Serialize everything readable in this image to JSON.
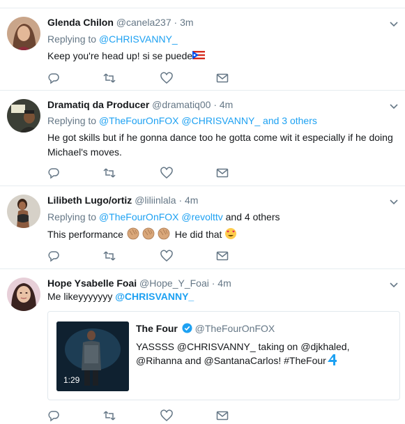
{
  "tweets": [
    {
      "name": "Glenda Chilon",
      "handle": "@canela237",
      "time": "3m",
      "reply_prefix": "Replying to",
      "reply_targets": "@CHRISVANNY_",
      "text": "Keep you're head up! si se puede",
      "emoji": "flag-puerto-rico-icon"
    },
    {
      "name": "Dramatiq da Producer",
      "handle": "@dramatiq00",
      "time": "4m",
      "reply_prefix": "Replying to",
      "reply_targets": "@TheFourOnFOX @CHRISVANNY_",
      "reply_others": "and 3 others",
      "text": "He got skills but if he gonna dance too he gotta come wit it especially if he doing Michael's moves."
    },
    {
      "name": "Lilibeth Lugo/ortiz",
      "handle": "@liliinlala",
      "time": "4m",
      "reply_prefix": "Replying to",
      "reply_targets": "@TheFourOnFOX @revolttv",
      "reply_others": "and 4 others",
      "text_before": "This performance",
      "text_after": "He did that"
    },
    {
      "name": "Hope Ysabelle Foai",
      "handle": "@Hope_Y_Foai",
      "time": "4m",
      "text_before": "Me likeyyyyyyy",
      "mention": "@CHRISVANNY_"
    }
  ],
  "dot": "·",
  "quoted": {
    "name": "The Four",
    "handle": "@TheFourOnFOX",
    "text": "YASSSS @CHRISVANNY_ taking on @djkhaled, @Rihanna and @SantanaCarlos! #TheFour",
    "duration": "1:29"
  },
  "icons": {
    "reply": "reply-icon",
    "retweet": "retweet-icon",
    "like": "heart-icon",
    "dm": "envelope-icon",
    "more": "chevron-down-icon"
  },
  "colors": {
    "link": "#1da1f2",
    "secondary": "#657786",
    "divider": "#e6ecf0"
  }
}
